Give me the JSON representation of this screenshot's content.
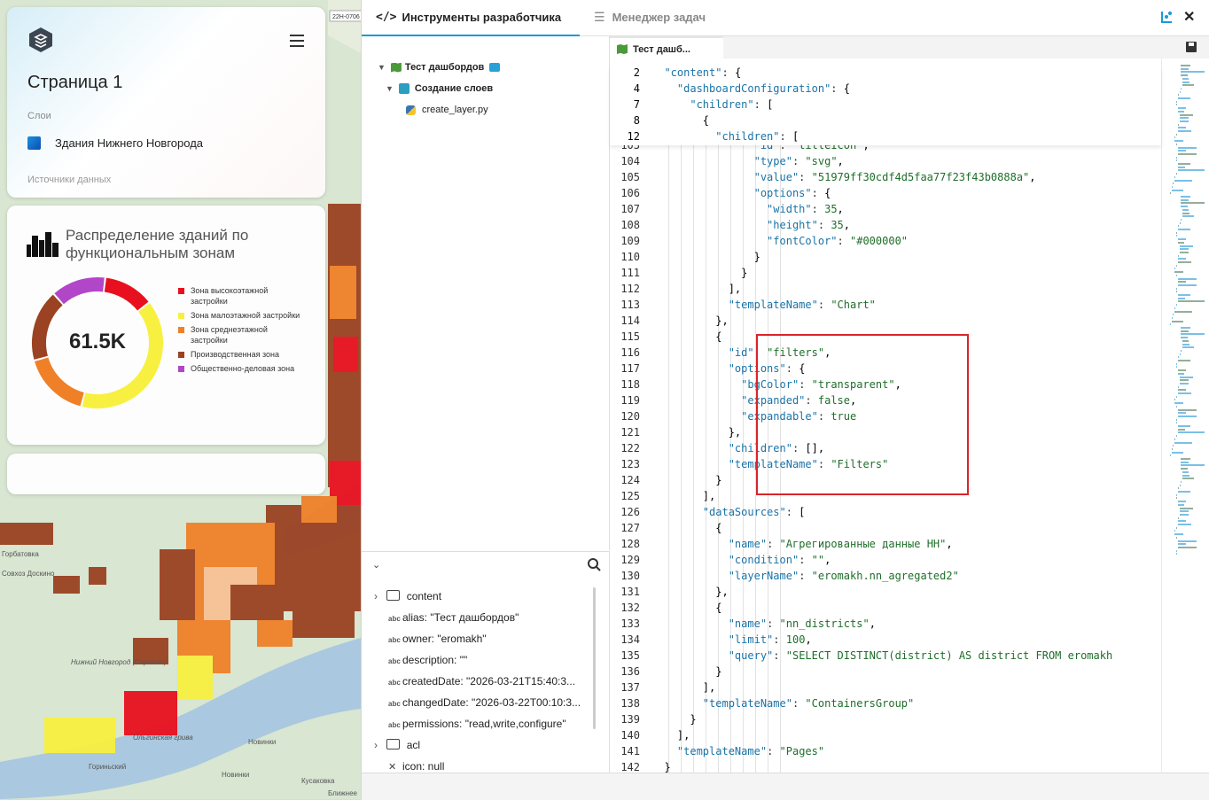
{
  "map": {
    "road_label": "22Н-0706",
    "places": [
      "Горбатовка",
      "Совхоз Доскино",
      "Нижний Новгород (Сормово)",
      "Новинки",
      "Новинки",
      "Кусаковка",
      "Ближнее",
      "Ольгинская грива",
      "Гориньский"
    ]
  },
  "page_card": {
    "title": "Страница 1",
    "layers_label": "Слои",
    "layer_name": "Здания Нижнего Новгорода",
    "sources_label": "Источники данных"
  },
  "chart_card": {
    "title": "Распределение зданий по функциональным зонам",
    "center_value": "61.5K"
  },
  "chart_data": {
    "type": "pie",
    "center_label": "61.5K",
    "title": "Распределение зданий по функциональным зонам",
    "legend_position": "right",
    "series": [
      {
        "name": "Зона высокоэтажной застройки",
        "value": 12,
        "color": "#e8101e"
      },
      {
        "name": "Зона малоэтажной застройки",
        "value": 38,
        "color": "#f8f040"
      },
      {
        "name": "Зона среднеэтажной застройки",
        "value": 16,
        "color": "#f08028"
      },
      {
        "name": "Производственная зона",
        "value": 17,
        "color": "#9a4222"
      },
      {
        "name": "Общественно-деловая зона",
        "value": 13,
        "color": "#b246c8"
      }
    ]
  },
  "devtools": {
    "tab_active": "Инструменты разработчика",
    "tab_other": "Менеджер задач",
    "file_tab": "Тест дашб...",
    "tree": {
      "root": "Тест дашбордов",
      "child": "Создание слоев",
      "file": "create_layer.py"
    },
    "props": {
      "folder1": "content",
      "rows": [
        "alias: \"Тест дашбордов\"",
        "owner: \"eromakh\"",
        "description: \"\"",
        "createdDate: \"2026-03-21T15:40:3...",
        "changedDate: \"2026-03-22T00:10:3...",
        "permissions: \"read,write,configure\""
      ],
      "folder2": "acl",
      "icon_row": "icon: null"
    }
  },
  "code": {
    "sticky": [
      {
        "ln": "2",
        "text": "  \"content\": {"
      },
      {
        "ln": "4",
        "text": "    \"dashboardConfiguration\": {"
      },
      {
        "ln": "7",
        "text": "      \"children\": ["
      },
      {
        "ln": "8",
        "text": "        {"
      },
      {
        "ln": "12",
        "text": "          \"children\": ["
      }
    ],
    "lines": [
      {
        "ln": "103",
        "text": "                \"id\": \"titleIcon\","
      },
      {
        "ln": "104",
        "text": "                \"type\": \"svg\","
      },
      {
        "ln": "105",
        "text": "                \"value\": \"51979ff30cdf4d5faa77f23f43b0888a\","
      },
      {
        "ln": "106",
        "text": "                \"options\": {"
      },
      {
        "ln": "107",
        "text": "                  \"width\": 35,"
      },
      {
        "ln": "108",
        "text": "                  \"height\": 35,"
      },
      {
        "ln": "109",
        "text": "                  \"fontColor\": \"#000000\""
      },
      {
        "ln": "110",
        "text": "                }"
      },
      {
        "ln": "111",
        "text": "              }"
      },
      {
        "ln": "112",
        "text": "            ],"
      },
      {
        "ln": "113",
        "text": "            \"templateName\": \"Chart\""
      },
      {
        "ln": "114",
        "text": "          },"
      },
      {
        "ln": "115",
        "text": "          {"
      },
      {
        "ln": "116",
        "text": "            \"id\": \"filters\","
      },
      {
        "ln": "117",
        "text": "            \"options\": {"
      },
      {
        "ln": "118",
        "text": "              \"bgColor\": \"transparent\","
      },
      {
        "ln": "119",
        "text": "              \"expanded\": false,"
      },
      {
        "ln": "120",
        "text": "              \"expandable\": true"
      },
      {
        "ln": "121",
        "text": "            },"
      },
      {
        "ln": "122",
        "text": "            \"children\": [],"
      },
      {
        "ln": "123",
        "text": "            \"templateName\": \"Filters\""
      },
      {
        "ln": "124",
        "text": "          }"
      },
      {
        "ln": "125",
        "text": "        ],"
      },
      {
        "ln": "126",
        "text": "        \"dataSources\": ["
      },
      {
        "ln": "127",
        "text": "          {"
      },
      {
        "ln": "128",
        "text": "            \"name\": \"Агрегированные данные НН\","
      },
      {
        "ln": "129",
        "text": "            \"condition\": \"\","
      },
      {
        "ln": "130",
        "text": "            \"layerName\": \"eromakh.nn_agregated2\""
      },
      {
        "ln": "131",
        "text": "          },"
      },
      {
        "ln": "132",
        "text": "          {"
      },
      {
        "ln": "133",
        "text": "            \"name\": \"nn_districts\","
      },
      {
        "ln": "134",
        "text": "            \"limit\": 100,"
      },
      {
        "ln": "135",
        "text": "            \"query\": \"SELECT DISTINCT(district) AS district FROM eromakh"
      },
      {
        "ln": "136",
        "text": "          }"
      },
      {
        "ln": "137",
        "text": "        ],"
      },
      {
        "ln": "138",
        "text": "        \"templateName\": \"ContainersGroup\""
      },
      {
        "ln": "139",
        "text": "      }"
      },
      {
        "ln": "140",
        "text": "    ],"
      },
      {
        "ln": "141",
        "text": "    \"templateName\": \"Pages\""
      },
      {
        "ln": "142",
        "text": "  }"
      }
    ]
  }
}
